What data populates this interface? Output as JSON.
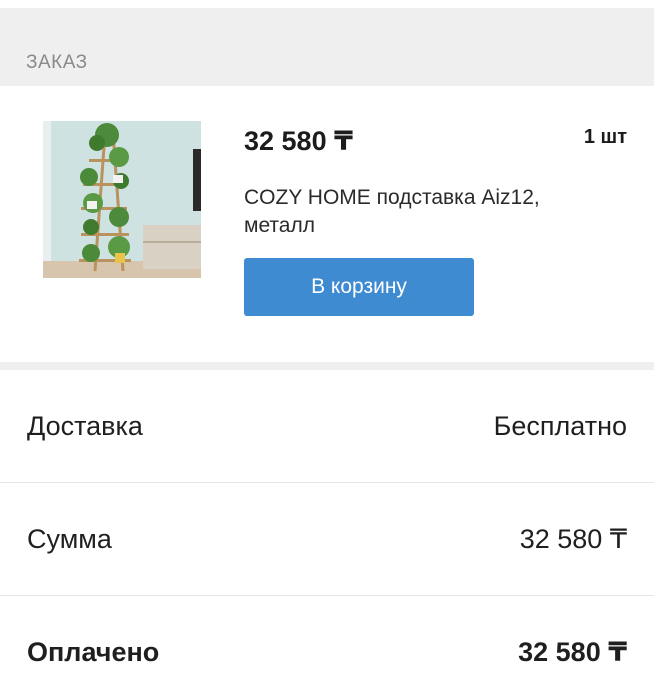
{
  "order": {
    "section_title": "ЗАКАЗ",
    "item": {
      "image": "plant-stand-photo",
      "price": "32 580 ₸",
      "quantity": "1 шт",
      "title": "COZY HOME подставка Aiz12, металл",
      "cart_button_label": "В корзину"
    }
  },
  "summary": {
    "delivery": {
      "label": "Доставка",
      "value": "Бесплатно"
    },
    "total": {
      "label": "Сумма",
      "value": "32 580 ₸"
    },
    "paid": {
      "label": "Оплачено",
      "value": "32 580 ₸"
    }
  },
  "colors": {
    "button": "#3e8bd2",
    "section_bg": "#efefef"
  }
}
